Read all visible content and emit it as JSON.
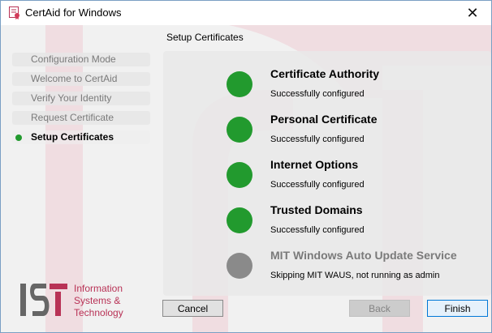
{
  "window": {
    "title": "CertAid for Windows",
    "close_glyph": "✕"
  },
  "header": {
    "title": "Setup Certificates"
  },
  "nav": {
    "items": [
      {
        "label": "Configuration Mode",
        "state": "inactive"
      },
      {
        "label": "Welcome to CertAid",
        "state": "inactive"
      },
      {
        "label": "Verify Your Identity",
        "state": "inactive"
      },
      {
        "label": "Request Certificate",
        "state": "inactive"
      },
      {
        "label": "Setup Certificates",
        "state": "active"
      }
    ]
  },
  "steps": [
    {
      "title": "Certificate Authority",
      "status": "Successfully configured",
      "result": "success"
    },
    {
      "title": "Personal Certificate",
      "status": "Successfully configured",
      "result": "success"
    },
    {
      "title": "Internet Options",
      "status": "Successfully configured",
      "result": "success"
    },
    {
      "title": "Trusted Domains",
      "status": "Successfully configured",
      "result": "success"
    },
    {
      "title": "MIT Windows Auto Update Service",
      "status": "Skipping MIT WAUS, not running as admin",
      "result": "skipped"
    }
  ],
  "logo": {
    "mark": "IST",
    "line1": "Information",
    "line2": "Systems &",
    "line3": "Technology"
  },
  "buttons": {
    "cancel": "Cancel",
    "back": "Back",
    "finish": "Finish"
  },
  "colors": {
    "success": "#229a2e",
    "skipped": "#8a8a8a",
    "brand": "#b83256",
    "accent": "#0078d7"
  }
}
